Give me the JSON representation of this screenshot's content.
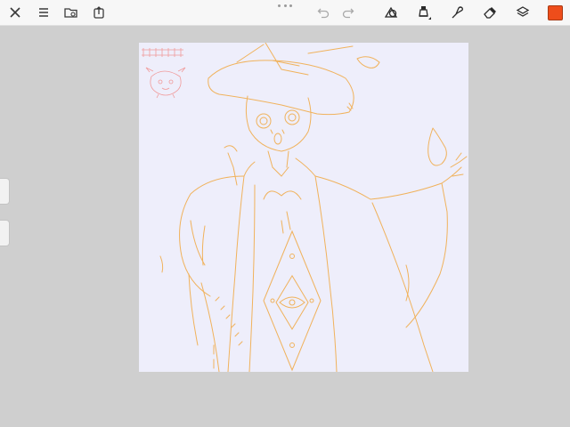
{
  "toolbar": {
    "left_icons": [
      "close-icon",
      "menu-icon",
      "gallery-icon",
      "export-icon"
    ],
    "center_icons": [
      "undo-icon",
      "redo-icon"
    ],
    "right_icons": [
      "shape-tool-icon",
      "brush-tool-icon",
      "smudge-tool-icon",
      "eraser-tool-icon",
      "layers-icon"
    ],
    "current_color": "#ee4d1b"
  },
  "canvas": {
    "background": "#eeeefb",
    "stroke_color": "#f0b25c",
    "watermark_color": "#f09a9a",
    "watermark_text": "雨月夜枕公主"
  },
  "side_handles": [
    "brush-size-handle",
    "brush-opacity-handle"
  ]
}
